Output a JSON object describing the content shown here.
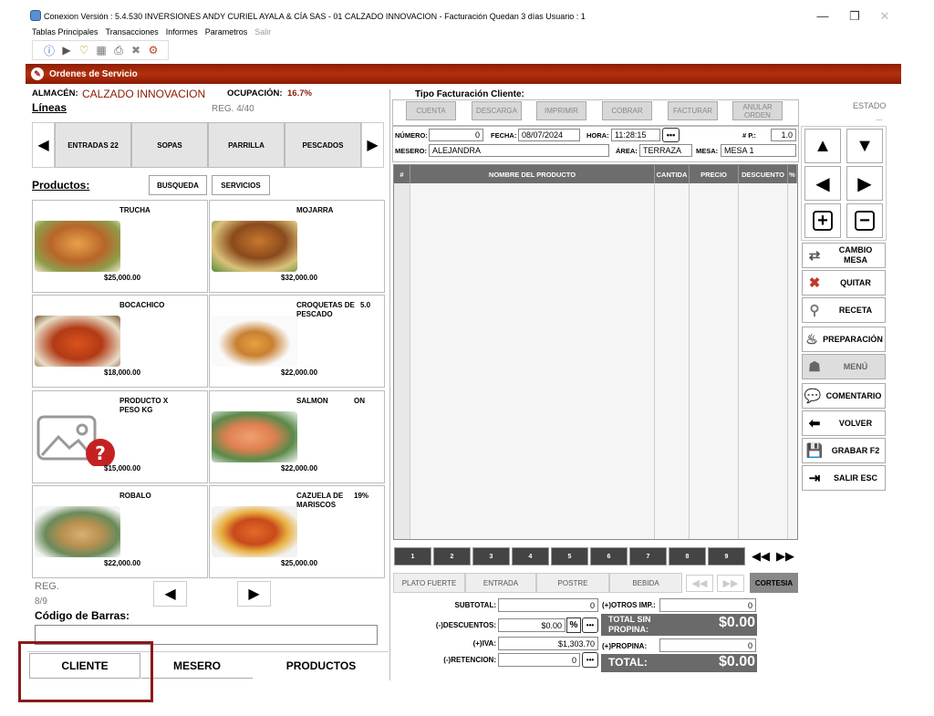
{
  "window": {
    "title": "Conexion Versión : 5.4.530 INVERSIONES ANDY CURIEL AYALA & CÍA SAS - 01 CALZADO INNOVACION - Facturación  Quedan      3 días   Usuario : 1",
    "minimize": "—",
    "restore": "❐",
    "close": "✕"
  },
  "menu": {
    "items": [
      "Tablas Principales",
      "Transacciones",
      "Informes",
      "Parametros"
    ],
    "disabled": "Salir"
  },
  "toolbar": {
    "icons": [
      "ⓘ",
      "▶",
      "♡",
      "▦",
      "⎙",
      "✖",
      "⚙"
    ]
  },
  "module_title": "Ordenes de Servicio",
  "almacen": {
    "label": "ALMACÉN:",
    "value": "CALZADO INNOVACION"
  },
  "ocupacion": {
    "label": "OCUPACIÓN:",
    "value": "16.7%"
  },
  "lineas": {
    "label": "Líneas",
    "reg": "REG.  4/40"
  },
  "categories": [
    "ENTRADAS 22",
    "SOPAS",
    "PARRILLA",
    "PESCADOS"
  ],
  "productos": {
    "label": "Productos:",
    "busqueda": "BUSQUEDA",
    "servicios": "SERVICIOS"
  },
  "products": [
    {
      "name": "TRUCHA",
      "price": "$25,000.00",
      "extra": "",
      "icon": "fish-plate"
    },
    {
      "name": "MOJARRA",
      "price": "$32,000.00",
      "extra": "",
      "icon": "fried-fish"
    },
    {
      "name": "BOCACHICO",
      "price": "$18,000.00",
      "extra": "",
      "icon": "soup-bowl"
    },
    {
      "name": "CROQUETAS DE PESCADO",
      "price": "$22,000.00",
      "extra": "5.0",
      "icon": "croquettes"
    },
    {
      "name": "PRODUCTO X PESO KG",
      "price": "$15,000.00",
      "extra": "",
      "icon": "no-image"
    },
    {
      "name": "SALMON",
      "price": "$22,000.00",
      "extra": "ON",
      "icon": "salmon"
    },
    {
      "name": "ROBALO",
      "price": "$22,000.00",
      "extra": "",
      "icon": "fish-fillet"
    },
    {
      "name": "CAZUELA DE MARISCOS",
      "price": "$25,000.00",
      "extra": "19%",
      "icon": "seafood-stew"
    }
  ],
  "reg_products": {
    "label": "REG.",
    "value": "8/9"
  },
  "barcode": {
    "label": "Código de Barras:",
    "value": ""
  },
  "tabs": [
    "CLIENTE",
    "MESERO",
    "PRODUCTOS"
  ],
  "facturacion": {
    "label": "Tipo Facturación Cliente:",
    "buttons": [
      "CUENTA",
      "DESCARGA",
      "IMPRIMIR",
      "COBRAR",
      "FACTURAR",
      "ANULAR ORDEN"
    ],
    "estado_label": "ESTADO",
    "estado_value": "..."
  },
  "order": {
    "numero_label": "NÚMERO:",
    "numero": "0",
    "fecha_label": "FECHA:",
    "fecha": "08/07/2024",
    "hora_label": "HORA:",
    "hora": "11:28:15",
    "np_label": "# P.:",
    "np": "1.0",
    "mesero_label": "MESERO:",
    "mesero": "ALEJANDRA",
    "area_label": "ÁREA:",
    "area": "TERRAZA",
    "mesa_label": "MESA:",
    "mesa": "MESA 1"
  },
  "grid_headers": [
    "#",
    "NOMBRE DEL PRODUCTO",
    "CANTIDA",
    "PRECIO",
    "DESCUENTO",
    "%"
  ],
  "pages": [
    "1",
    "2",
    "3",
    "4",
    "5",
    "6",
    "7",
    "8",
    "9"
  ],
  "plate_tabs": [
    "PLATO FUERTE",
    "ENTRADA",
    "POSTRE",
    "BEBIDA"
  ],
  "cortesia": "CORTESIA",
  "totals": {
    "subtotal_label": "SUBTOTAL:",
    "subtotal": "0",
    "descuentos_label": "(-)DESCUENTOS:",
    "descuentos": "$0.00",
    "iva_label": "(+)IVA:",
    "iva": "$1,303.70",
    "retencion_label": "(-)RETENCION:",
    "retencion": "0",
    "otros_label": "(+)OTROS IMP.:",
    "otros": "0",
    "total_sin_label": "TOTAL SIN PROPINA:",
    "total_sin": "$0.00",
    "propina_label": "(+)PROPINA:",
    "propina": "0",
    "total_label": "TOTAL:",
    "total": "$0.00"
  },
  "actions": [
    {
      "label": "CAMBIO MESA",
      "icon": "swap-table-icon"
    },
    {
      "label": "QUITAR",
      "icon": "remove-icon"
    },
    {
      "label": "RECETA",
      "icon": "search-icon"
    },
    {
      "label": "PREPARACIÓN",
      "icon": "chef-hat-icon"
    },
    {
      "label": "MENÚ",
      "icon": "menu-icon"
    },
    {
      "label": "COMENTARIO",
      "icon": "comment-icon"
    },
    {
      "label": "VOLVER",
      "icon": "back-arrow-icon"
    },
    {
      "label": "GRABAR F2",
      "icon": "save-icon"
    },
    {
      "label": "SALIR ESC",
      "icon": "exit-icon"
    }
  ],
  "colors": {
    "brand_red": "#a8280a",
    "highlight_box": "#8b1a1a",
    "dark_gray": "#6a6a6a"
  }
}
